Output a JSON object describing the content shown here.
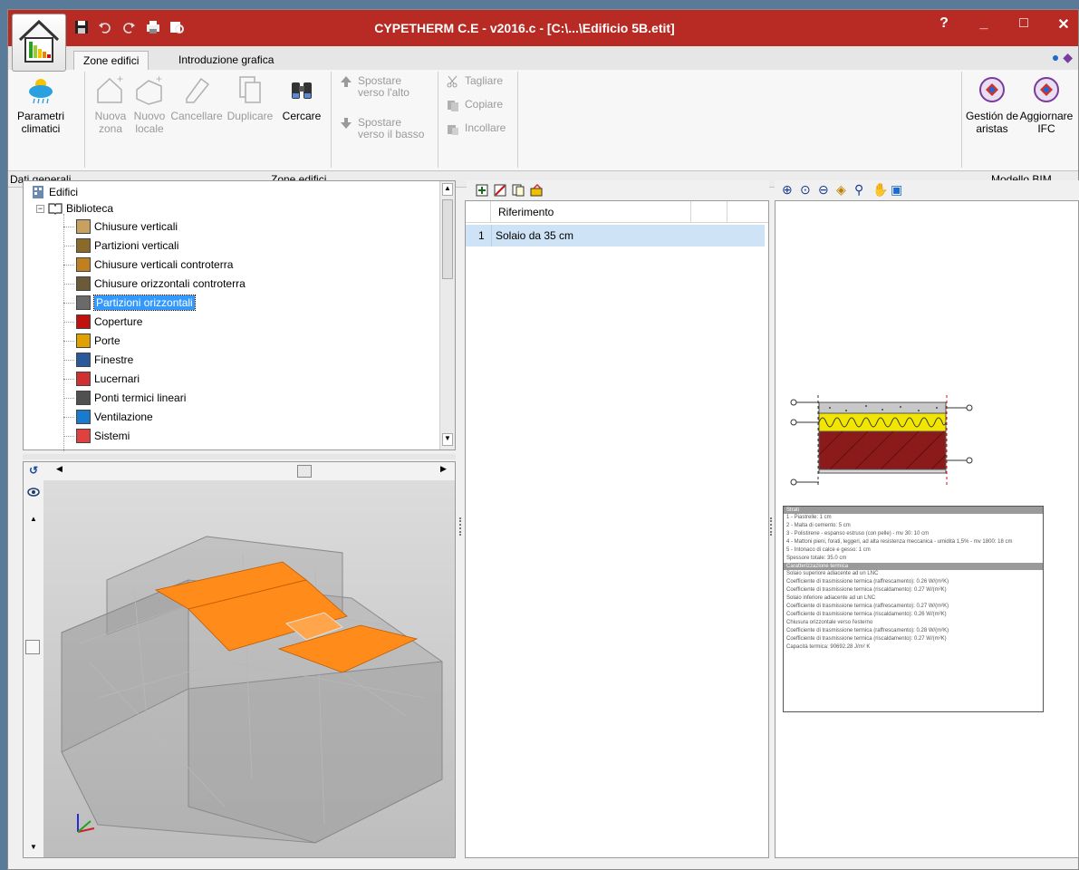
{
  "window": {
    "title": "CYPETHERM C.E - v2016.c - [C:\\...\\Edificio 5B.etit]",
    "help": "?",
    "minimize": "_",
    "maximize": "□",
    "close": "✕"
  },
  "tabs": [
    {
      "label": "Zone edifici",
      "active": true
    },
    {
      "label": "Introduzione grafica",
      "active": false
    }
  ],
  "ribbon": {
    "parametri": "Parametri climatici",
    "nuova_zona": "Nuova zona",
    "nuovo_locale": "Nuovo locale",
    "cancellare": "Cancellare",
    "duplicare": "Duplicare",
    "cercare": "Cercare",
    "spostare_alto": "Spostare verso l'alto",
    "spostare_basso": "Spostare verso il basso",
    "tagliare": "Tagliare",
    "copiare": "Copiare",
    "incollare": "Incollare",
    "gestion_aristas": "Gestión de aristas",
    "aggiornare_ifc": "Aggiornare IFC"
  },
  "groups": {
    "dati_generali": "Dati generali",
    "zone_edifici": "Zone edifici",
    "modello_bim": "Modello BIM"
  },
  "tree": {
    "root": "Edifici",
    "library": "Biblioteca",
    "items": [
      "Chiusure verticali",
      "Partizioni verticali",
      "Chiusure verticali controterra",
      "Chiusure orizzontali controterra",
      "Partizioni orizzontali",
      "Coperture",
      "Porte",
      "Finestre",
      "Lucernari",
      "Ponti termici lineari",
      "Ventilazione",
      "Sistemi"
    ],
    "selected_index": 4
  },
  "grid": {
    "header": "Riferimento",
    "rows": [
      {
        "num": "1",
        "name": "Solaio da 35 cm"
      }
    ]
  },
  "detail": {
    "strati_title": "Strati",
    "strati": [
      "1 - Piastrelle: 1 cm",
      "2 - Malta di cemento: 5 cm",
      "3 - Polistirene - espanso estruso (con pelle) - mv 30: 10 cm",
      "4 - Mattoni pieni, forati, leggeri, ad alta resistenza meccanica - umidità 1,5% - mv 1800: 18 cm",
      "5 - Intonaco di calce e gesso: 1 cm",
      "Spessore totale: 35.0 cm"
    ],
    "caratt_title": "Caratterizzazione termica",
    "caratt": [
      "Solaio superiore adiacente ad un LNC",
      "Coefficiente di trasmissione termica (raffrescamento): 0.26 W/(m²K)",
      "Coefficiente di trasmissione termica (riscaldamento): 0.27 W/(m²K)",
      "Solaio inferiore adiacente ad un LNC",
      "Coefficiente di trasmissione termica (raffrescamento): 0.27 W/(m²K)",
      "Coefficiente di trasmissione termica (riscaldamento): 0.26 W/(m²K)",
      "Chiusura orizzontale verso l'esterno",
      "Coefficiente di trasmissione termica (raffrescamento): 0.28 W/(m²K)",
      "Coefficiente di trasmissione termica (riscaldamento): 0.27 W/(m²K)",
      "Capacità termica: 90692.28 J/m² K"
    ]
  },
  "colors": {
    "titlebar": "#b72b24",
    "selection": "#3399ff",
    "slab": "#ff8c1a",
    "insulation": "#f2e600",
    "brick": "#8b1a1a"
  },
  "icons": [
    "home-icon",
    "save-icon",
    "undo-icon",
    "redo-icon",
    "weather-icon",
    "binoculars-icon",
    "bim-icon"
  ]
}
